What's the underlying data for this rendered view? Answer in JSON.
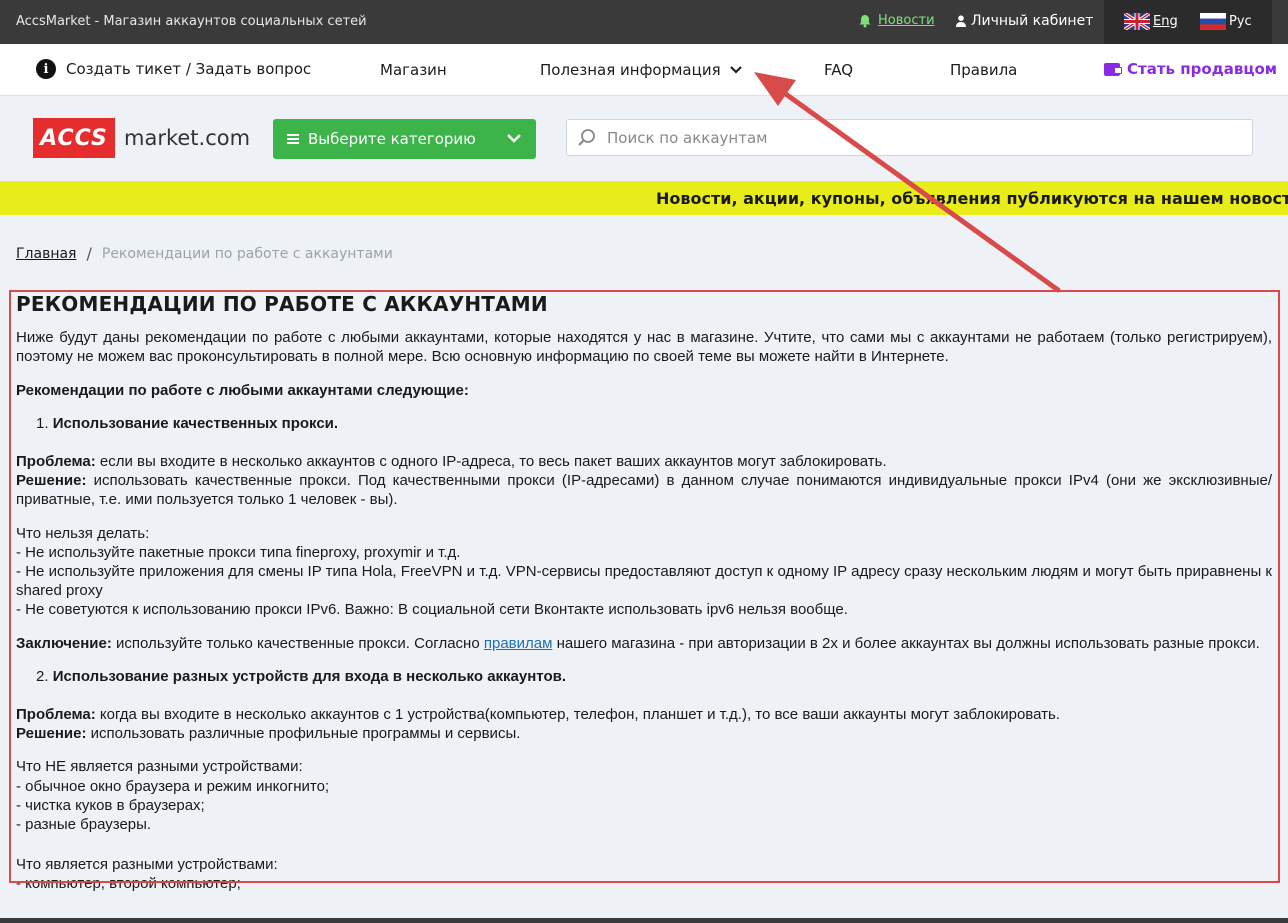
{
  "topbar": {
    "site_title": "AccsMarket - Магазин аккаунтов социальных сетей",
    "news_label": "Новости",
    "cabinet_label": "Личный кабинет",
    "lang_eng": "Eng",
    "lang_rus": "Рус"
  },
  "nav": {
    "ticket_label": "Создать тикет / Задать вопрос",
    "shop_label": "Магазин",
    "info_label": "Полезная информация",
    "faq_label": "FAQ",
    "rules_label": "Правила",
    "seller_label": "Стать продавцом"
  },
  "header": {
    "logo_box": "ACCS",
    "logo_text": "market.com",
    "category_label": "Выберите категорию",
    "search_placeholder": "Поиск по аккаунтам"
  },
  "ticker": {
    "text": "Новости, акции, купоны, объявления публикуются на нашем новостном канале"
  },
  "breadcrumb": {
    "home": "Главная",
    "separator": "/",
    "current": "Рекомендации по работе с аккаунтами"
  },
  "article": {
    "title": "РЕКОМЕНДАЦИИ ПО РАБОТЕ С АККАУНТАМИ",
    "intro": "Ниже будут даны рекомендации по работе с любыми аккаунтами, которые находятся у нас в магазине. Учтите, что сами мы с аккаунтами не работаем (только регистрируем), поэтому не можем вас проконсультировать в полной мере. Всю основную информацию по своей теме вы можете найти в Интернете.",
    "subtitle": "Рекомендации по работе с любыми аккаунтами следующие:",
    "item1_num": "1.",
    "item1": "Использование качественных прокси.",
    "problem_label": "Проблема:",
    "problem1": "если вы входите в несколько аккаунтов с одного IP-адреса, то весь пакет ваших аккаунтов могут заблокировать.",
    "solution_label": "Решение:",
    "solution1": "использовать качественные прокси. Под качественными прокси (IP-адресами) в данном случае понимаются индивидуальные прокси IPv4 (они же эксклюзивные/приватные, т.е. ими пользуется только 1 человек - вы).",
    "dont_title": "Что нельзя делать:",
    "dont1": "- Не используйте пакетные прокси типа fineproxy, proxymir и т.д.",
    "dont2": "- Не используйте приложения для смены IP типа Hola, FreeVPN и т.д. VPN-сервисы предоставляют доступ к одному IP адресу сразу нескольким людям и могут быть приравнены к shared proxy",
    "dont3": "- Не советуются к использованию прокси IPv6. Важно: В социальной сети Вконтакте использовать ipv6 нельзя вообще.",
    "conclusion_label": "Заключение:",
    "conclusion_a": "используйте только качественные прокси. Согласно",
    "conclusion_link": "правилам",
    "conclusion_b": "нашего магазина - при авторизации в 2х и более аккаунтах вы должны использовать разные прокси.",
    "item2_num": "2.",
    "item2": "Использование разных устройств для входа в несколько аккаунтов.",
    "problem2": "когда вы входите в несколько аккаунтов с 1 устройства(компьютер, телефон, планшет и т.д.), то все ваши аккаунты могут заблокировать.",
    "solution2": "использовать различные профильные программы и сервисы.",
    "notdiff_title": "Что НЕ является разными устройствами:",
    "notdiff1": "- обычное окно браузера и режим инкогнито;",
    "notdiff2": "- чистка куков в браузерах;",
    "notdiff3": "- разные браузеры.",
    "diff_title": "Что является разными устройствами:",
    "diff1": "- компьютер, второй компьютер;"
  },
  "colors": {
    "accent_green": "#3cb44a",
    "logo_red": "#e52d2d",
    "ticker_yellow": "#e8ec1a",
    "seller_purple": "#8a2be2",
    "annotation_red": "#d94a4a"
  }
}
